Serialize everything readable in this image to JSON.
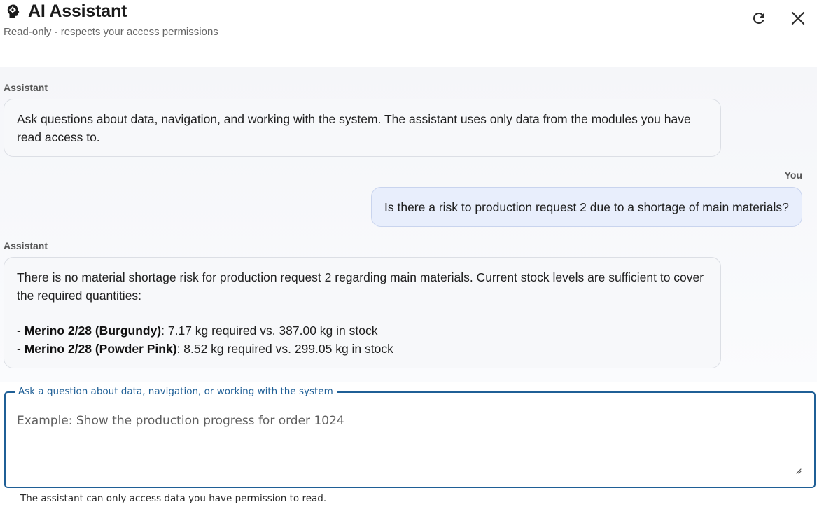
{
  "header": {
    "icon": "brain-head-icon",
    "title": "AI Assistant",
    "subtitle": "Read-only · respects your access permissions",
    "refresh_icon": "refresh-icon",
    "close_icon": "close-icon"
  },
  "messages": [
    {
      "role_label": "Assistant",
      "text": "Ask questions about data, navigation, and working with the system. The assistant uses only data from the modules you have read access to."
    },
    {
      "role_label": "You",
      "text": "Is there a risk to production request 2 due to a shortage of main materials?"
    },
    {
      "role_label": "Assistant",
      "intro": "There is no material shortage risk for production request 2 regarding main materials. Current stock levels are sufficient to cover the required quantities:",
      "items": [
        {
          "bullet": "- ",
          "name": "Merino 2/28 (Burgundy)",
          "detail": ": 7.17 kg required vs. 387.00 kg in stock"
        },
        {
          "bullet": "- ",
          "name": "Merino 2/28 (Powder Pink)",
          "detail": ": 8.52 kg required vs. 299.05 kg in stock"
        }
      ]
    }
  ],
  "input": {
    "label": "Ask a question about data, navigation, or working with the system",
    "placeholder": "Example: Show the production progress for order 1024",
    "value": "",
    "helper": "The assistant can only access data you have permission to read."
  },
  "colors": {
    "accent": "#1f5f96",
    "user_bubble": "#e8eefc",
    "assistant_bubble": "#f7f8fa"
  }
}
